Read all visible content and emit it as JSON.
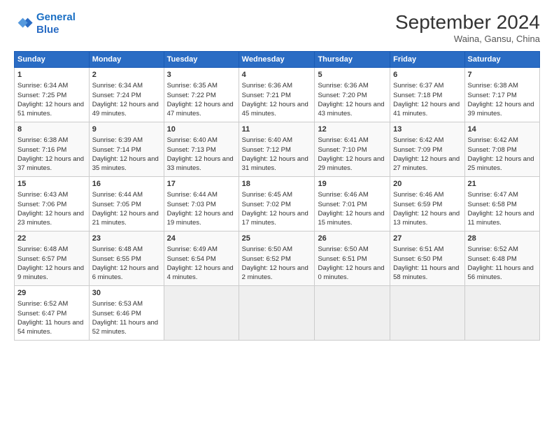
{
  "header": {
    "logo_line1": "General",
    "logo_line2": "Blue",
    "month": "September 2024",
    "location": "Waina, Gansu, China"
  },
  "days_of_week": [
    "Sunday",
    "Monday",
    "Tuesday",
    "Wednesday",
    "Thursday",
    "Friday",
    "Saturday"
  ],
  "weeks": [
    [
      {
        "day": 1,
        "sunrise": "6:34 AM",
        "sunset": "7:25 PM",
        "daylight": "12 hours and 51 minutes."
      },
      {
        "day": 2,
        "sunrise": "6:34 AM",
        "sunset": "7:24 PM",
        "daylight": "12 hours and 49 minutes."
      },
      {
        "day": 3,
        "sunrise": "6:35 AM",
        "sunset": "7:22 PM",
        "daylight": "12 hours and 47 minutes."
      },
      {
        "day": 4,
        "sunrise": "6:36 AM",
        "sunset": "7:21 PM",
        "daylight": "12 hours and 45 minutes."
      },
      {
        "day": 5,
        "sunrise": "6:36 AM",
        "sunset": "7:20 PM",
        "daylight": "12 hours and 43 minutes."
      },
      {
        "day": 6,
        "sunrise": "6:37 AM",
        "sunset": "7:18 PM",
        "daylight": "12 hours and 41 minutes."
      },
      {
        "day": 7,
        "sunrise": "6:38 AM",
        "sunset": "7:17 PM",
        "daylight": "12 hours and 39 minutes."
      }
    ],
    [
      {
        "day": 8,
        "sunrise": "6:38 AM",
        "sunset": "7:16 PM",
        "daylight": "12 hours and 37 minutes."
      },
      {
        "day": 9,
        "sunrise": "6:39 AM",
        "sunset": "7:14 PM",
        "daylight": "12 hours and 35 minutes."
      },
      {
        "day": 10,
        "sunrise": "6:40 AM",
        "sunset": "7:13 PM",
        "daylight": "12 hours and 33 minutes."
      },
      {
        "day": 11,
        "sunrise": "6:40 AM",
        "sunset": "7:12 PM",
        "daylight": "12 hours and 31 minutes."
      },
      {
        "day": 12,
        "sunrise": "6:41 AM",
        "sunset": "7:10 PM",
        "daylight": "12 hours and 29 minutes."
      },
      {
        "day": 13,
        "sunrise": "6:42 AM",
        "sunset": "7:09 PM",
        "daylight": "12 hours and 27 minutes."
      },
      {
        "day": 14,
        "sunrise": "6:42 AM",
        "sunset": "7:08 PM",
        "daylight": "12 hours and 25 minutes."
      }
    ],
    [
      {
        "day": 15,
        "sunrise": "6:43 AM",
        "sunset": "7:06 PM",
        "daylight": "12 hours and 23 minutes."
      },
      {
        "day": 16,
        "sunrise": "6:44 AM",
        "sunset": "7:05 PM",
        "daylight": "12 hours and 21 minutes."
      },
      {
        "day": 17,
        "sunrise": "6:44 AM",
        "sunset": "7:03 PM",
        "daylight": "12 hours and 19 minutes."
      },
      {
        "day": 18,
        "sunrise": "6:45 AM",
        "sunset": "7:02 PM",
        "daylight": "12 hours and 17 minutes."
      },
      {
        "day": 19,
        "sunrise": "6:46 AM",
        "sunset": "7:01 PM",
        "daylight": "12 hours and 15 minutes."
      },
      {
        "day": 20,
        "sunrise": "6:46 AM",
        "sunset": "6:59 PM",
        "daylight": "12 hours and 13 minutes."
      },
      {
        "day": 21,
        "sunrise": "6:47 AM",
        "sunset": "6:58 PM",
        "daylight": "12 hours and 11 minutes."
      }
    ],
    [
      {
        "day": 22,
        "sunrise": "6:48 AM",
        "sunset": "6:57 PM",
        "daylight": "12 hours and 9 minutes."
      },
      {
        "day": 23,
        "sunrise": "6:48 AM",
        "sunset": "6:55 PM",
        "daylight": "12 hours and 6 minutes."
      },
      {
        "day": 24,
        "sunrise": "6:49 AM",
        "sunset": "6:54 PM",
        "daylight": "12 hours and 4 minutes."
      },
      {
        "day": 25,
        "sunrise": "6:50 AM",
        "sunset": "6:52 PM",
        "daylight": "12 hours and 2 minutes."
      },
      {
        "day": 26,
        "sunrise": "6:50 AM",
        "sunset": "6:51 PM",
        "daylight": "12 hours and 0 minutes."
      },
      {
        "day": 27,
        "sunrise": "6:51 AM",
        "sunset": "6:50 PM",
        "daylight": "11 hours and 58 minutes."
      },
      {
        "day": 28,
        "sunrise": "6:52 AM",
        "sunset": "6:48 PM",
        "daylight": "11 hours and 56 minutes."
      }
    ],
    [
      {
        "day": 29,
        "sunrise": "6:52 AM",
        "sunset": "6:47 PM",
        "daylight": "11 hours and 54 minutes."
      },
      {
        "day": 30,
        "sunrise": "6:53 AM",
        "sunset": "6:46 PM",
        "daylight": "11 hours and 52 minutes."
      },
      null,
      null,
      null,
      null,
      null
    ]
  ]
}
